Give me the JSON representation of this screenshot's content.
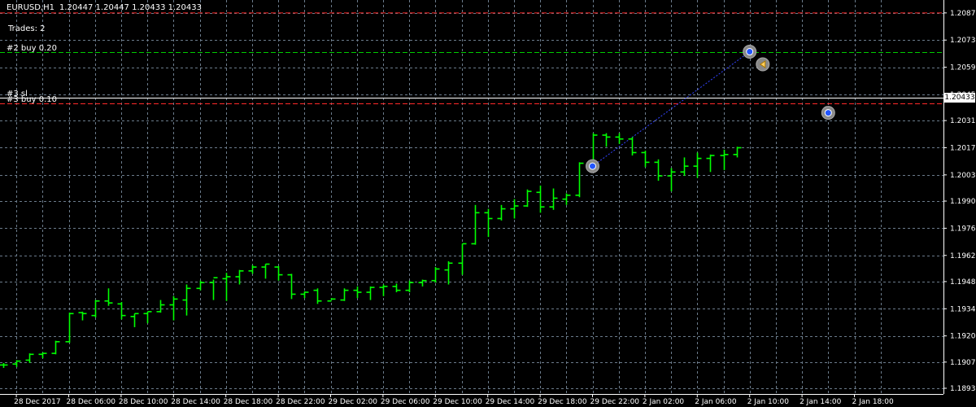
{
  "header": {
    "symbol": "EURUSD,H1",
    "ohlc": "1.20447 1.20447 1.20433 1.20433",
    "trades": "Trades: 2"
  },
  "order_lines": [
    {
      "label": "#2 buy 0.20",
      "price": 1.2067,
      "color": "#00cc00"
    },
    {
      "label": "#3 sl",
      "price": 1.20433,
      "color": "#ffffff"
    },
    {
      "label": "#3 buy 0.10",
      "price": 1.20405,
      "color": "#ff2a2a"
    }
  ],
  "stop_line": {
    "price": 1.2087,
    "color": "#ff2a2a"
  },
  "current_price": {
    "label": "1.20433",
    "price": 1.20433
  },
  "colors": {
    "background": "#000000",
    "grid": "#6b7b8b",
    "bar": "#00ff00",
    "axis": "#ffffff"
  },
  "chart_data": {
    "type": "ohlc",
    "symbol": "EURUSD",
    "timeframe": "H1",
    "ylim": [
      1.18935,
      1.20882
    ],
    "y_ticks": [
      "1.20870",
      "1.20730",
      "1.20590",
      "1.20450",
      "1.20315",
      "1.20175",
      "1.20035",
      "1.19900",
      "1.19760",
      "1.19620",
      "1.19485",
      "1.19345",
      "1.19205",
      "1.19070",
      "1.18935"
    ],
    "x_ticks": [
      {
        "bar": 1,
        "label": "28 Dec 2017"
      },
      {
        "bar": 5,
        "label": "28 Dec 06:00"
      },
      {
        "bar": 9,
        "label": "28 Dec 10:00"
      },
      {
        "bar": 13,
        "label": "28 Dec 14:00"
      },
      {
        "bar": 17,
        "label": "28 Dec 18:00"
      },
      {
        "bar": 21,
        "label": "28 Dec 22:00"
      },
      {
        "bar": 25,
        "label": "29 Dec 02:00"
      },
      {
        "bar": 29,
        "label": "29 Dec 06:00"
      },
      {
        "bar": 33,
        "label": "29 Dec 10:00"
      },
      {
        "bar": 37,
        "label": "29 Dec 14:00"
      },
      {
        "bar": 41,
        "label": "29 Dec 18:00"
      },
      {
        "bar": 45,
        "label": "29 Dec 22:00"
      },
      {
        "bar": 49,
        "label": "2 Jan 02:00"
      },
      {
        "bar": 53,
        "label": "2 Jan 06:00"
      },
      {
        "bar": 57,
        "label": "2 Jan 10:00"
      },
      {
        "bar": 61,
        "label": "2 Jan 14:00"
      },
      {
        "bar": 65,
        "label": "2 Jan 18:00"
      }
    ],
    "bars": [
      {
        "o": 1.19055,
        "h": 1.19065,
        "l": 1.1904,
        "c": 1.19055
      },
      {
        "o": 1.1906,
        "h": 1.1908,
        "l": 1.19045,
        "c": 1.19075
      },
      {
        "o": 1.1908,
        "h": 1.19115,
        "l": 1.19065,
        "c": 1.1911
      },
      {
        "o": 1.1911,
        "h": 1.1912,
        "l": 1.1909,
        "c": 1.19115
      },
      {
        "o": 1.19115,
        "h": 1.1918,
        "l": 1.1911,
        "c": 1.19175
      },
      {
        "o": 1.19175,
        "h": 1.19325,
        "l": 1.1917,
        "c": 1.1932
      },
      {
        "o": 1.19325,
        "h": 1.1933,
        "l": 1.19285,
        "c": 1.1932
      },
      {
        "o": 1.1931,
        "h": 1.1939,
        "l": 1.193,
        "c": 1.19385
      },
      {
        "o": 1.19385,
        "h": 1.1945,
        "l": 1.1936,
        "c": 1.19375
      },
      {
        "o": 1.1937,
        "h": 1.1938,
        "l": 1.1929,
        "c": 1.1931
      },
      {
        "o": 1.19305,
        "h": 1.1932,
        "l": 1.1925,
        "c": 1.1932
      },
      {
        "o": 1.1932,
        "h": 1.1933,
        "l": 1.1927,
        "c": 1.1933
      },
      {
        "o": 1.1933,
        "h": 1.1939,
        "l": 1.19325,
        "c": 1.19365
      },
      {
        "o": 1.19365,
        "h": 1.1941,
        "l": 1.19285,
        "c": 1.19395
      },
      {
        "o": 1.1939,
        "h": 1.1947,
        "l": 1.1931,
        "c": 1.1945
      },
      {
        "o": 1.1945,
        "h": 1.1949,
        "l": 1.1944,
        "c": 1.1948
      },
      {
        "o": 1.1948,
        "h": 1.19495,
        "l": 1.1939,
        "c": 1.19505
      },
      {
        "o": 1.195,
        "h": 1.1953,
        "l": 1.19385,
        "c": 1.1951
      },
      {
        "o": 1.1951,
        "h": 1.19545,
        "l": 1.1947,
        "c": 1.1954
      },
      {
        "o": 1.1954,
        "h": 1.1957,
        "l": 1.19525,
        "c": 1.1956
      },
      {
        "o": 1.1956,
        "h": 1.19575,
        "l": 1.195,
        "c": 1.19575
      },
      {
        "o": 1.1956,
        "h": 1.19565,
        "l": 1.1949,
        "c": 1.1952
      },
      {
        "o": 1.1952,
        "h": 1.19525,
        "l": 1.19395,
        "c": 1.1942
      },
      {
        "o": 1.1942,
        "h": 1.19435,
        "l": 1.194,
        "c": 1.1943
      },
      {
        "o": 1.1944,
        "h": 1.1945,
        "l": 1.1937,
        "c": 1.19385
      },
      {
        "o": 1.19385,
        "h": 1.194,
        "l": 1.1939,
        "c": 1.19395
      },
      {
        "o": 1.1939,
        "h": 1.1945,
        "l": 1.19385,
        "c": 1.1944
      },
      {
        "o": 1.1944,
        "h": 1.1946,
        "l": 1.194,
        "c": 1.1943
      },
      {
        "o": 1.1943,
        "h": 1.1946,
        "l": 1.1939,
        "c": 1.19455
      },
      {
        "o": 1.19455,
        "h": 1.1947,
        "l": 1.1941,
        "c": 1.1946
      },
      {
        "o": 1.1946,
        "h": 1.19475,
        "l": 1.1943,
        "c": 1.1944
      },
      {
        "o": 1.1944,
        "h": 1.1949,
        "l": 1.1943,
        "c": 1.1948
      },
      {
        "o": 1.1948,
        "h": 1.19495,
        "l": 1.1946,
        "c": 1.1949
      },
      {
        "o": 1.1949,
        "h": 1.1956,
        "l": 1.1948,
        "c": 1.1955
      },
      {
        "o": 1.19545,
        "h": 1.1959,
        "l": 1.1947,
        "c": 1.1958
      },
      {
        "o": 1.1958,
        "h": 1.1968,
        "l": 1.1952,
        "c": 1.1968
      },
      {
        "o": 1.1968,
        "h": 1.1988,
        "l": 1.19675,
        "c": 1.1984
      },
      {
        "o": 1.1984,
        "h": 1.1986,
        "l": 1.19715,
        "c": 1.1981
      },
      {
        "o": 1.1981,
        "h": 1.1988,
        "l": 1.198,
        "c": 1.1986
      },
      {
        "o": 1.1986,
        "h": 1.1991,
        "l": 1.1981,
        "c": 1.19875
      },
      {
        "o": 1.19875,
        "h": 1.1996,
        "l": 1.1987,
        "c": 1.1995
      },
      {
        "o": 1.19945,
        "h": 1.1998,
        "l": 1.1984,
        "c": 1.1987
      },
      {
        "o": 1.1987,
        "h": 1.19965,
        "l": 1.19855,
        "c": 1.19915
      },
      {
        "o": 1.1991,
        "h": 1.1994,
        "l": 1.1988,
        "c": 1.1993
      },
      {
        "o": 1.1993,
        "h": 1.201,
        "l": 1.1992,
        "c": 1.20095
      },
      {
        "o": 1.20095,
        "h": 1.2025,
        "l": 1.2009,
        "c": 1.2024
      },
      {
        "o": 1.2024,
        "h": 1.2025,
        "l": 1.2018,
        "c": 1.2023
      },
      {
        "o": 1.2023,
        "h": 1.2025,
        "l": 1.20195,
        "c": 1.2022
      },
      {
        "o": 1.2022,
        "h": 1.2023,
        "l": 1.20135,
        "c": 1.2015
      },
      {
        "o": 1.2015,
        "h": 1.2016,
        "l": 1.20075,
        "c": 1.201
      },
      {
        "o": 1.201,
        "h": 1.20115,
        "l": 1.20005,
        "c": 1.2003
      },
      {
        "o": 1.2003,
        "h": 1.2007,
        "l": 1.1995,
        "c": 1.2005
      },
      {
        "o": 1.2005,
        "h": 1.20125,
        "l": 1.2003,
        "c": 1.2008
      },
      {
        "o": 1.2008,
        "h": 1.2015,
        "l": 1.2002,
        "c": 1.2012
      },
      {
        "o": 1.2012,
        "h": 1.2014,
        "l": 1.2005,
        "c": 1.20135
      },
      {
        "o": 1.20135,
        "h": 1.20165,
        "l": 1.2006,
        "c": 1.2014
      },
      {
        "o": 1.2014,
        "h": 1.2018,
        "l": 1.20125,
        "c": 1.20175
      }
    ],
    "trade_markers": [
      {
        "bar": 45,
        "price": 1.2008,
        "type": "buy",
        "label": "entry"
      },
      {
        "bar": 57,
        "price": 1.2067,
        "type": "buy",
        "label": "entry"
      },
      {
        "bar": 58,
        "price": 1.20605,
        "type": "close",
        "label": "close"
      },
      {
        "bar": 63,
        "price": 1.20355,
        "type": "buy",
        "label": "entry"
      }
    ]
  }
}
